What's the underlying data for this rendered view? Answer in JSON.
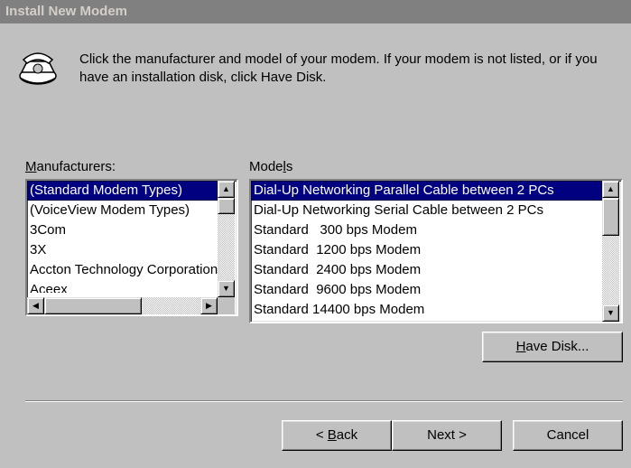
{
  "window": {
    "title": "Install New Modem"
  },
  "intro": {
    "text": "Click the manufacturer and model of your modem. If your modem is not listed, or if you have an installation disk, click Have Disk."
  },
  "manufacturers": {
    "label_pre": "",
    "label_key": "M",
    "label_post": "anufacturers:",
    "items": [
      {
        "label": "(Standard Modem Types)",
        "selected": true
      },
      {
        "label": "(VoiceView Modem Types)",
        "selected": false
      },
      {
        "label": "3Com",
        "selected": false
      },
      {
        "label": "3X",
        "selected": false
      },
      {
        "label": "Accton Technology Corporation",
        "selected": false
      },
      {
        "label": "Aceex",
        "selected": false
      }
    ]
  },
  "models": {
    "label_pre": "Mode",
    "label_key": "l",
    "label_post": "s",
    "items": [
      {
        "label": "Dial-Up Networking Parallel Cable between 2 PCs",
        "selected": true
      },
      {
        "label": "Dial-Up Networking Serial Cable between 2 PCs",
        "selected": false
      },
      {
        "label": "Standard   300 bps Modem",
        "selected": false
      },
      {
        "label": "Standard  1200 bps Modem",
        "selected": false
      },
      {
        "label": "Standard  2400 bps Modem",
        "selected": false
      },
      {
        "label": "Standard  9600 bps Modem",
        "selected": false
      },
      {
        "label": "Standard 14400 bps Modem",
        "selected": false
      }
    ]
  },
  "buttons": {
    "have_disk": {
      "key": "H",
      "rest": "ave Disk..."
    },
    "back": {
      "pre": "< ",
      "key": "B",
      "rest": "ack"
    },
    "next": {
      "label": "Next >"
    },
    "cancel": {
      "label": "Cancel"
    }
  },
  "icons": {
    "dialog_icon": "telephone-icon",
    "up": "scroll-up-arrow-icon",
    "down": "scroll-down-arrow-icon",
    "left": "scroll-left-arrow-icon",
    "right": "scroll-right-arrow-icon"
  },
  "colors": {
    "selection": "#000080",
    "face": "#c0c0c0",
    "title_inactive": "#808080"
  }
}
